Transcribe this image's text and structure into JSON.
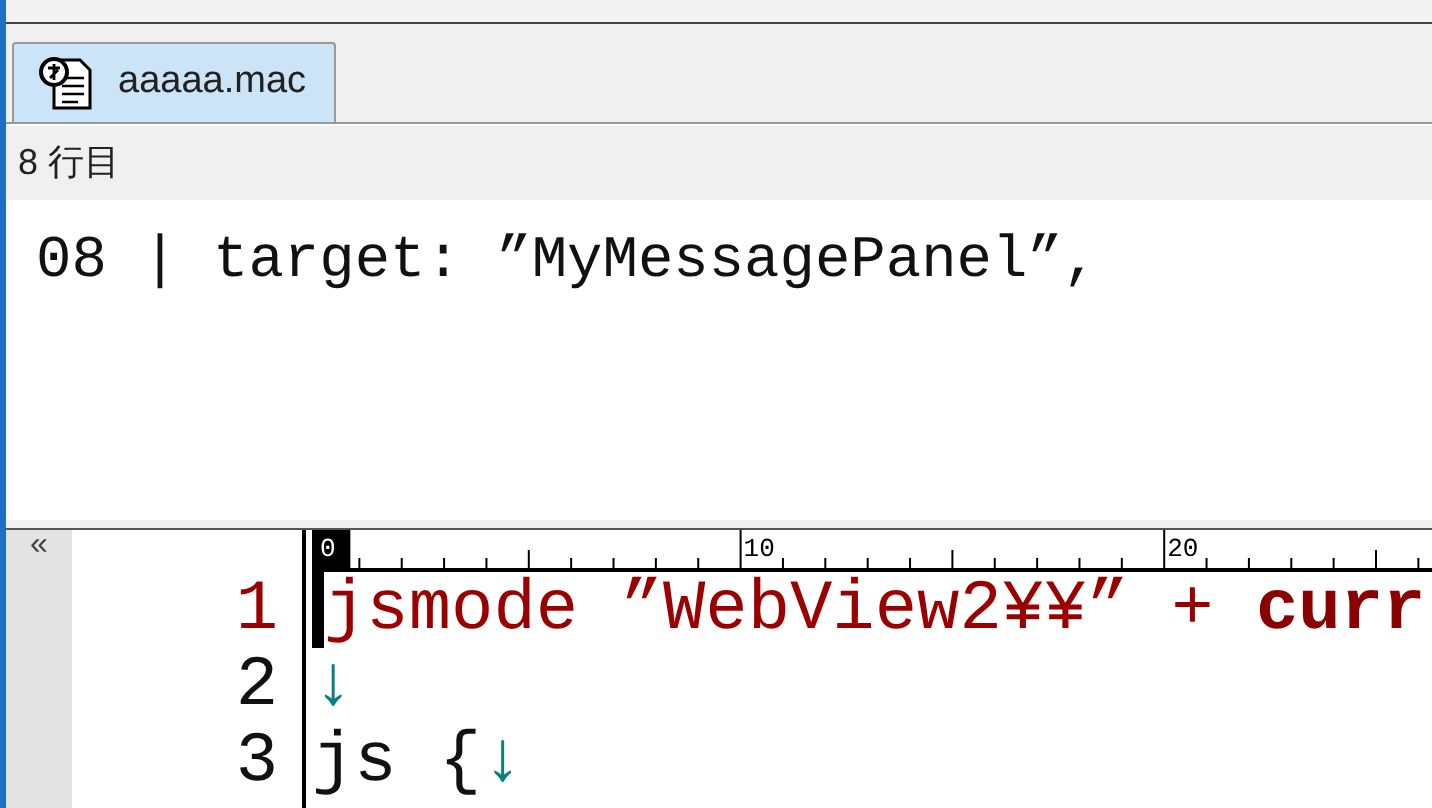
{
  "tabs": [
    {
      "label": "aaaaa.mac",
      "selected": true
    }
  ],
  "status": "8 行目",
  "preview": "08 | target: ”MyMessagePanel”,",
  "collapse_button": "«",
  "ruler": {
    "labels": [
      "0",
      "10",
      "20"
    ]
  },
  "lines": [
    {
      "number": "1",
      "current": true,
      "segments": [
        {
          "text": "jsmode ”WebView2¥¥” + ",
          "kind": "string"
        },
        {
          "text": "curr",
          "kind": "keyword"
        }
      ]
    },
    {
      "number": "2",
      "current": false,
      "segments": [
        {
          "text": "↓",
          "kind": "newline"
        }
      ]
    },
    {
      "number": "3",
      "current": false,
      "segments": [
        {
          "text": "js {",
          "kind": "plain"
        },
        {
          "text": "↓",
          "kind": "newline"
        }
      ]
    }
  ]
}
